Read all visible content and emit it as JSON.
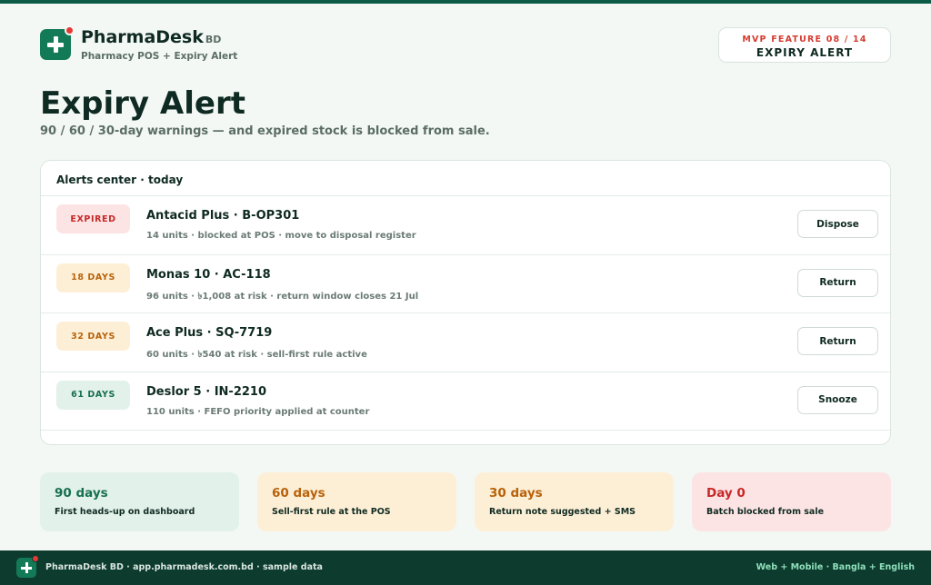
{
  "app": {
    "name": "PharmaDesk",
    "name_suffix": "BD",
    "tagline": "Pharmacy POS + Expiry Alert"
  },
  "feature": {
    "kicker": "MVP FEATURE 08 / 14",
    "title": "EXPIRY ALERT"
  },
  "page": {
    "title": "Expiry Alert",
    "subtitle": "90 / 60 / 30-day warnings — and expired stock is blocked from sale."
  },
  "alerts": {
    "header": "Alerts center · today",
    "items": [
      {
        "badge": "EXPIRED",
        "status": "expired",
        "title": "Antacid Plus · B-OP301",
        "meta": "14 units · blocked at POS · move to disposal register",
        "action": "Dispose"
      },
      {
        "badge": "18 DAYS",
        "status": "warn",
        "title": "Monas 10 · AC-118",
        "meta": "96 units ·  ৳1,008 at risk · return window closes 21 Jul",
        "action": "Return"
      },
      {
        "badge": "32 DAYS",
        "status": "warn",
        "title": "Ace Plus · SQ-7719",
        "meta": "60 units ·  ৳540 at risk · sell-first rule active",
        "action": "Return"
      },
      {
        "badge": "61 DAYS",
        "status": "safe",
        "title": "Deslor 5 · IN-2210",
        "meta": "110 units · FEFO priority applied at counter",
        "action": "Snooze"
      }
    ]
  },
  "tiers": [
    {
      "title": "90 days",
      "desc": "First heads-up on dashboard"
    },
    {
      "title": "60 days",
      "desc": "Sell-first rule at the POS"
    },
    {
      "title": "30 days",
      "desc": "Return note suggested + SMS"
    },
    {
      "title": "Day 0",
      "desc": "Batch blocked from sale"
    }
  ],
  "footer": {
    "left": "PharmaDesk BD · app.pharmadesk.com.bd · sample data",
    "right": "Web + Mobile · Bangla + English"
  },
  "colors": {
    "brand_green": "#137a57",
    "footer_bg": "#0d3b2e",
    "expired_red": "#c62828",
    "warn_amber": "#b8620b",
    "safe_green": "#17704f"
  }
}
